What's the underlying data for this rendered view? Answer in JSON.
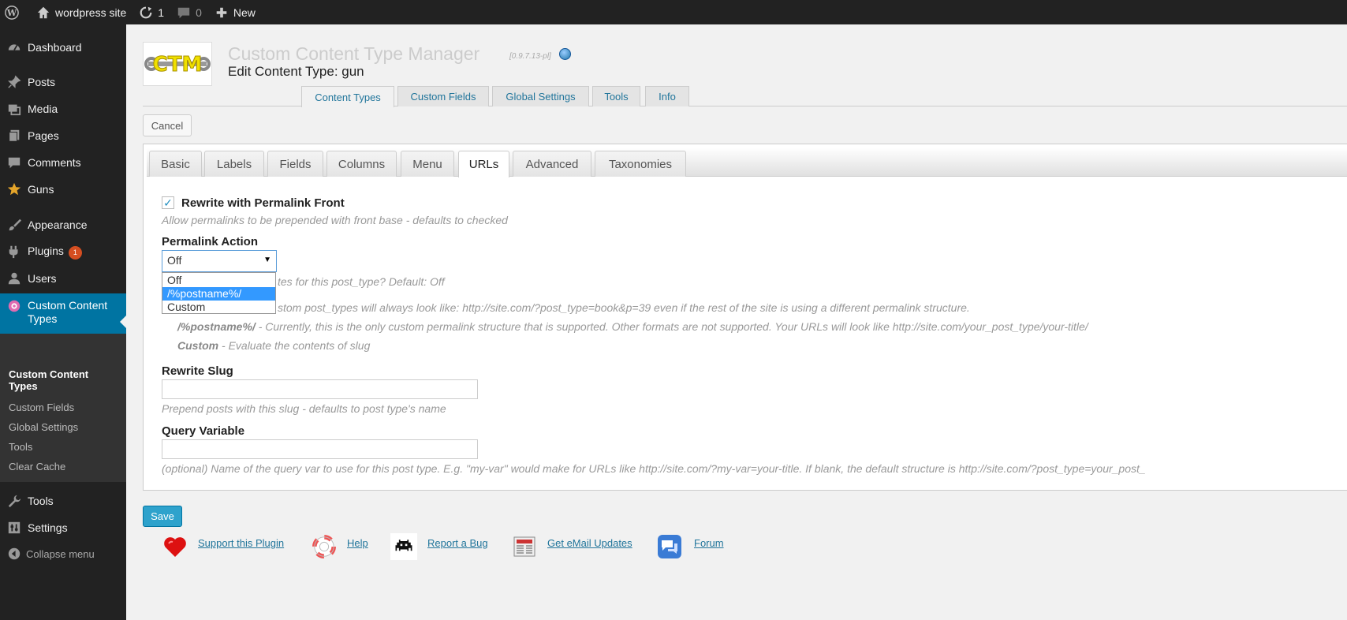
{
  "adminbar": {
    "site_name": "wordpress site",
    "updates_count": "1",
    "comments_count": "0",
    "new_label": "New"
  },
  "sidebar": {
    "items": [
      {
        "label": "Dashboard",
        "icon": "dashboard-icon"
      },
      {
        "label": "Posts",
        "icon": "pin-icon"
      },
      {
        "label": "Media",
        "icon": "media-icon"
      },
      {
        "label": "Pages",
        "icon": "pages-icon"
      },
      {
        "label": "Comments",
        "icon": "comments-icon"
      },
      {
        "label": "Guns",
        "icon": "star-icon"
      },
      {
        "label": "Appearance",
        "icon": "brush-icon"
      },
      {
        "label": "Plugins",
        "icon": "plugin-icon",
        "badge": "1"
      },
      {
        "label": "Users",
        "icon": "users-icon"
      },
      {
        "label": "Custom Content",
        "label2": "Types",
        "icon": "flower-icon"
      },
      {
        "label": "Tools",
        "icon": "wrench-icon"
      },
      {
        "label": "Settings",
        "icon": "settings-icon"
      },
      {
        "label": "Collapse menu",
        "icon": "collapse-icon"
      }
    ],
    "submenu": [
      {
        "label": "Custom Content",
        "label2": "Types"
      },
      {
        "label": "Custom Fields"
      },
      {
        "label": "Global Settings"
      },
      {
        "label": "Tools"
      },
      {
        "label": "Clear Cache"
      }
    ]
  },
  "header": {
    "title": "Custom Content Type Manager",
    "version": "[0.9.7.13-pl]",
    "subtitle": "Edit Content Type: gun",
    "logo_text": "CTM"
  },
  "nav_tabs": [
    "Content Types",
    "Custom Fields",
    "Global Settings",
    "Tools",
    "Info"
  ],
  "cancel_label": "Cancel",
  "inner_tabs": [
    "Basic",
    "Labels",
    "Fields",
    "Columns",
    "Menu",
    "URLs",
    "Advanced",
    "Taxonomies"
  ],
  "form": {
    "rewrite_front_label": "Rewrite with Permalink Front",
    "rewrite_front_checked": true,
    "rewrite_front_desc": "Allow permalinks to be prepended with front base - defaults to checked",
    "permalink_action_label": "Permalink Action",
    "permalink_action_value": "Off",
    "permalink_options": [
      "Off",
      "/%postname%/",
      "Custom"
    ],
    "permalink_desc_partial": "tes for this post_type? Default: Off",
    "off_desc_partial": "stom post_types will always look like: http://site.com/?post_type=book&p=39 even if the rest of the site is using a different permalink structure.",
    "postname_term": "/%postname%/",
    "postname_desc": " - Currently, this is the only custom permalink structure that is supported. Other formats are not supported. Your URLs will look like http://site.com/your_post_type/your-title/",
    "custom_term": "Custom",
    "custom_desc": " - Evaluate the contents of slug",
    "rewrite_slug_label": "Rewrite Slug",
    "rewrite_slug_value": "",
    "rewrite_slug_desc": "Prepend posts with this slug - defaults to post type's name",
    "query_var_label": "Query Variable",
    "query_var_value": "",
    "query_var_desc": "(optional) Name of the query var to use for this post type. E.g. \"my-var\" would make for URLs like http://site.com/?my-var=your-title. If blank, the default structure is http://site.com/?post_type=your_post_"
  },
  "save_label": "Save",
  "footer_links": [
    {
      "label": "Support this Plugin",
      "icon": "heart-icon"
    },
    {
      "label": "Help",
      "icon": "lifebuoy-icon"
    },
    {
      "label": "Report a Bug",
      "icon": "bug-icon"
    },
    {
      "label": "Get eMail Updates",
      "icon": "newspaper-icon"
    },
    {
      "label": "Forum",
      "icon": "forum-icon"
    }
  ],
  "colors": {
    "adminbar_bg": "#222222",
    "sidebar_current": "#0074a2",
    "link": "#21759b",
    "primary_button": "#2ea2cc"
  }
}
